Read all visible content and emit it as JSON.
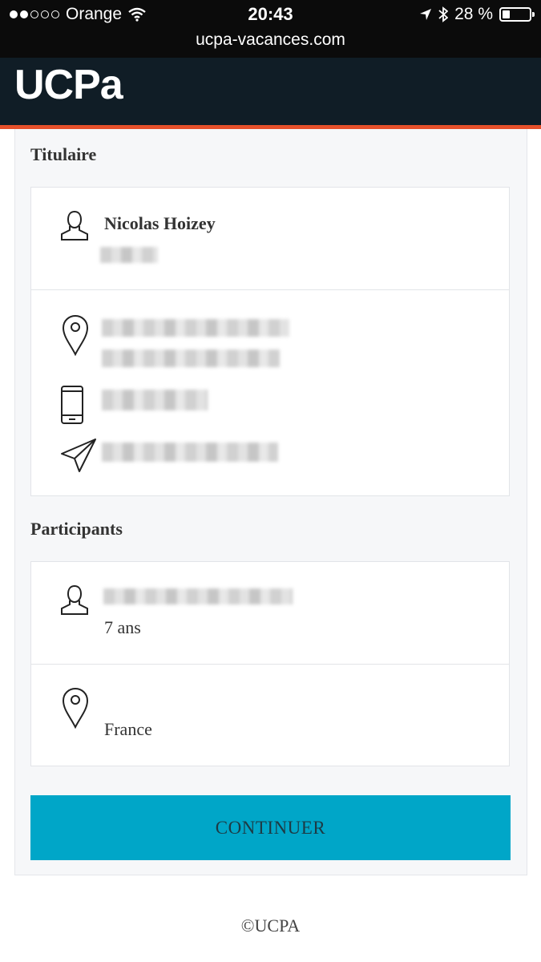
{
  "status_bar": {
    "carrier": "Orange",
    "time": "20:43",
    "battery": "28 %",
    "battery_level": 0.28
  },
  "browser": {
    "url": "ucpa-vacances.com"
  },
  "header": {
    "logo": "UCPa"
  },
  "titulaire": {
    "section_title": "Titulaire",
    "name": "Nicolas Hoizey"
  },
  "participants": {
    "section_title": "Participants",
    "age": "7 ans",
    "country": "France"
  },
  "actions": {
    "continue_label": "CONTINUER"
  },
  "footer": {
    "copyright": "©UCPA"
  },
  "icons": [
    "person-icon",
    "location-pin-icon",
    "phone-icon",
    "send-icon"
  ],
  "colors": {
    "header": "#101d26",
    "accent_stripe": "#e6502a",
    "button": "#00a6c8"
  }
}
